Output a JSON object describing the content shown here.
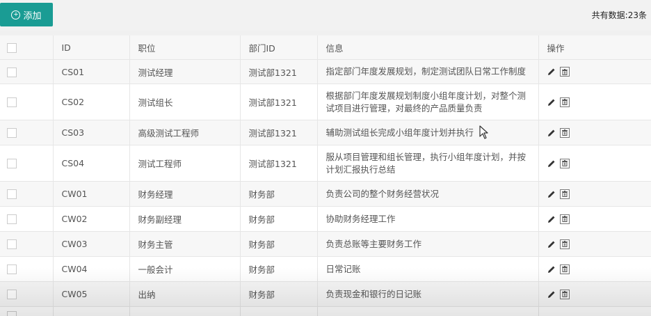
{
  "toolbar": {
    "add_label": "添加",
    "total_text": "共有数据:23条"
  },
  "table": {
    "headers": [
      "ID",
      "职位",
      "部门ID",
      "信息",
      "操作"
    ],
    "rows": [
      {
        "id": "CS01",
        "position": "测试经理",
        "dept": "测试部1321",
        "info": "指定部门年度发展规划，制定测试团队日常工作制度"
      },
      {
        "id": "CS02",
        "position": "测试组长",
        "dept": "测试部1321",
        "info": "根据部门年度发展规划制度小组年度计划，对整个测试项目进行管理，对最终的产品质量负责"
      },
      {
        "id": "CS03",
        "position": "高级测试工程师",
        "dept": "测试部1321",
        "info": "辅助测试组长完成小组年度计划并执行"
      },
      {
        "id": "CS04",
        "position": "测试工程师",
        "dept": "测试部1321",
        "info": "服从项目管理和组长管理，执行小组年度计划，并按计划汇报执行总结"
      },
      {
        "id": "CW01",
        "position": "财务经理",
        "dept": "财务部",
        "info": "负责公司的整个财务经营状况"
      },
      {
        "id": "CW02",
        "position": "财务副经理",
        "dept": "财务部",
        "info": "协助财务经理工作"
      },
      {
        "id": "CW03",
        "position": "财务主管",
        "dept": "财务部",
        "info": "负责总账等主要财务工作"
      },
      {
        "id": "CW04",
        "position": "一般会计",
        "dept": "财务部",
        "info": "日常记账"
      },
      {
        "id": "CW05",
        "position": "出纳",
        "dept": "财务部",
        "info": "负责现金和银行的日记账"
      },
      {
        "id": "",
        "position": "",
        "dept": "",
        "info": ""
      }
    ]
  },
  "icons": {
    "add": "plus-circle-icon",
    "edit": "pencil-icon",
    "delete": "trash-icon"
  },
  "colors": {
    "accent": "#1a9c94"
  }
}
